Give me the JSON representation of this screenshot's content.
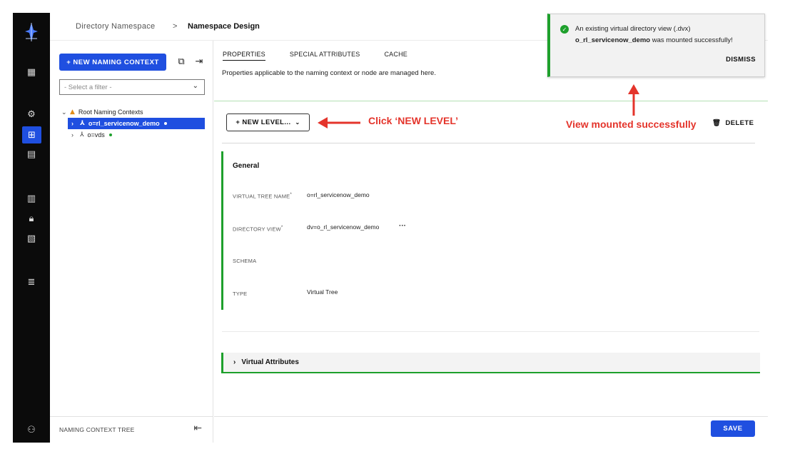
{
  "breadcrumb": {
    "parent": "Directory Namespace",
    "separator": ">",
    "current": "Namespace Design"
  },
  "left_panel": {
    "new_button": "+ NEW NAMING CONTEXT",
    "filter_placeholder": "- Select a filter -",
    "tree": {
      "root_label": "Root Naming Contexts",
      "items": [
        {
          "label": "o=rl_servicenow_demo",
          "selected": true
        },
        {
          "label": "o=vds",
          "selected": false
        }
      ]
    },
    "footer_label": "NAMING CONTEXT TREE"
  },
  "main": {
    "tabs": [
      "PROPERTIES",
      "SPECIAL ATTRIBUTES",
      "CACHE"
    ],
    "description": "Properties applicable to the naming context or node are managed here.",
    "new_level_button": "+ NEW LEVEL...",
    "delete_button": "DELETE",
    "general": {
      "title": "General",
      "fields": [
        {
          "label": "VIRTUAL TREE NAME",
          "required": "*",
          "value": "o=rl_servicenow_demo"
        },
        {
          "label": "DIRECTORY VIEW",
          "required": "*",
          "value": "dv=o_rl_servicenow_demo",
          "more": "···"
        },
        {
          "label": "SCHEMA",
          "value": ""
        },
        {
          "label": "TYPE",
          "value": "Virtual Tree"
        }
      ]
    },
    "virtual_attributes": "Virtual Attributes",
    "save_button": "SAVE"
  },
  "toast": {
    "line1": "An existing virtual directory view (.dvx)",
    "name": "o_rl_servicenow_demo",
    "line2_rest": " was mounted successfully!",
    "dismiss": "DISMISS"
  },
  "annotations": {
    "click_new_level": "Click ‘NEW LEVEL’",
    "view_mounted": "View mounted successfully"
  },
  "colors": {
    "primary": "#1f4fe0",
    "success": "#1ea02c",
    "annotation": "#e4342b",
    "warning": "#e08d18"
  }
}
